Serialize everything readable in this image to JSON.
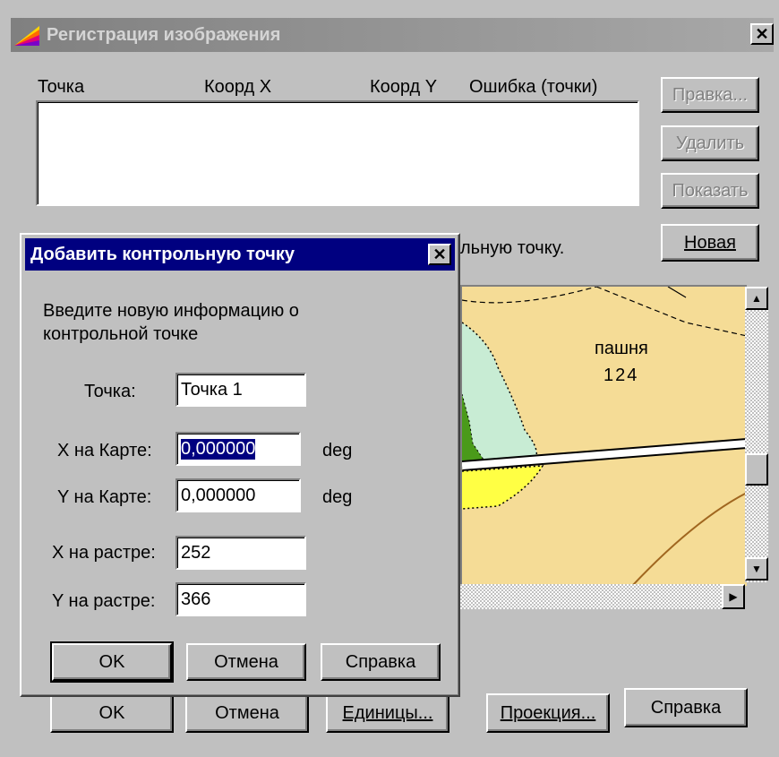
{
  "main_window": {
    "title": "Регистрация изображения",
    "close_glyph": "✕",
    "columns": [
      "Точка",
      "Коорд X",
      "Коорд Y",
      "Ошибка (точки)"
    ],
    "side_buttons": {
      "edit": "Правка...",
      "delete": "Удалить",
      "show": "Показать",
      "new": "Новая"
    },
    "hint_fragment": "льную точку.",
    "bottom_buttons": {
      "ok": "OK",
      "cancel": "Отмена",
      "units": "Единицы...",
      "projection": "Проекция...",
      "help": "Справка"
    },
    "map": {
      "label_name": "пашня",
      "label_number": "124"
    }
  },
  "dialog": {
    "title": "Добавить контрольную точку",
    "close_glyph": "✕",
    "instruction_line1": "Введите новую информацию о",
    "instruction_line2": "контрольной точке",
    "fields": {
      "point_label": "Точка:",
      "point_value": "Точка 1",
      "map_x_label": "X на Карте:",
      "map_x_value": "0,000000",
      "map_x_unit": "deg",
      "map_y_label": "Y на Карте:",
      "map_y_value": "0,000000",
      "map_y_unit": "deg",
      "raster_x_label": "X на растре:",
      "raster_x_value": "252",
      "raster_y_label": "Y на растре:",
      "raster_y_value": "366"
    },
    "buttons": {
      "ok": "OK",
      "cancel": "Отмена",
      "help": "Справка"
    }
  },
  "colors": {
    "title_active": "#000080",
    "title_inactive": "#808080",
    "map_field": "#f5dc96",
    "map_meadow": "#c8ecd4",
    "map_forest": "#4a9a1a",
    "map_yellow": "#ffff44"
  },
  "icons": [
    "app-logo-icon",
    "close-icon",
    "scroll-up-icon",
    "scroll-down-icon",
    "scroll-right-icon"
  ]
}
